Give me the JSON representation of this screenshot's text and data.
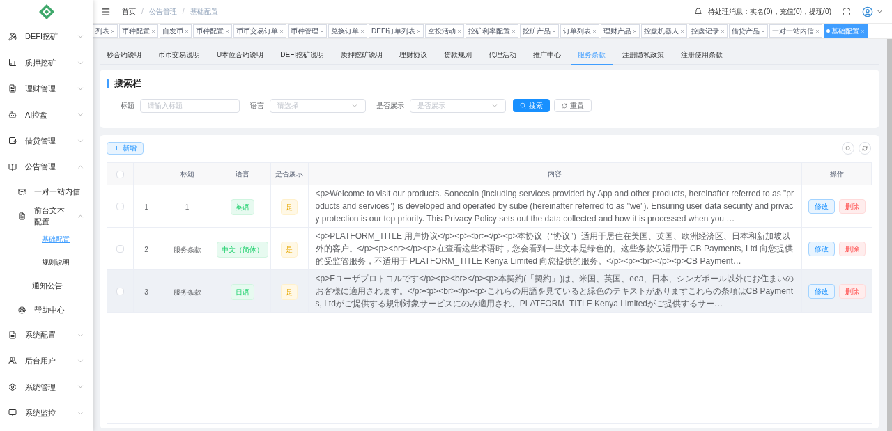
{
  "breadcrumb": {
    "separator": "/",
    "items": [
      "首页",
      "公告管理",
      "基础配置"
    ]
  },
  "header": {
    "notice": "待处理消息：实名(0)，充值(0)，提现(0)"
  },
  "sidebar": {
    "items": [
      {
        "label": "DEFI挖矿",
        "expanded": false
      },
      {
        "label": "质押挖矿",
        "expanded": false
      },
      {
        "label": "理财管理",
        "expanded": false
      },
      {
        "label": "AI控盘",
        "expanded": false
      },
      {
        "label": "借贷管理",
        "expanded": false
      },
      {
        "label": "公告管理",
        "expanded": true,
        "children": [
          {
            "label": "一对一站内信"
          },
          {
            "label": "前台文本配置",
            "expanded": true,
            "children": [
              {
                "label": "基础配置",
                "selected": true
              },
              {
                "label": "规则说明",
                "selected": false
              }
            ]
          },
          {
            "label": "通知公告"
          },
          {
            "label": "帮助中心"
          }
        ]
      },
      {
        "label": "系统配置",
        "expanded": false
      },
      {
        "label": "后台用户",
        "expanded": false
      },
      {
        "label": "系统管理",
        "expanded": false
      },
      {
        "label": "系统监控",
        "expanded": false
      }
    ]
  },
  "open_tabs": [
    {
      "label": "列表",
      "selected": false
    },
    {
      "label": "币种配置",
      "selected": false
    },
    {
      "label": "自发币",
      "selected": false
    },
    {
      "label": "币种配置",
      "selected": false
    },
    {
      "label": "币币交易订单",
      "selected": false
    },
    {
      "label": "币种管理",
      "selected": false
    },
    {
      "label": "兑换订单",
      "selected": false
    },
    {
      "label": "DEFI订单列表",
      "selected": false
    },
    {
      "label": "空投活动",
      "selected": false
    },
    {
      "label": "挖矿利率配置",
      "selected": false
    },
    {
      "label": "挖矿产品",
      "selected": false
    },
    {
      "label": "订单列表",
      "selected": false
    },
    {
      "label": "理财产品",
      "selected": false
    },
    {
      "label": "控盘机器人",
      "selected": false
    },
    {
      "label": "控盘记录",
      "selected": false
    },
    {
      "label": "借贷产品",
      "selected": false
    },
    {
      "label": "一对一站内信",
      "selected": false
    },
    {
      "label": "基础配置",
      "selected": true
    }
  ],
  "tabs": [
    {
      "label": "秒合约说明",
      "selected": false
    },
    {
      "label": "币币交易说明",
      "selected": false
    },
    {
      "label": "U本位合约说明",
      "selected": false
    },
    {
      "label": "DEFI挖矿说明",
      "selected": false
    },
    {
      "label": "质押挖矿说明",
      "selected": false
    },
    {
      "label": "理财协议",
      "selected": false
    },
    {
      "label": "贷款规则",
      "selected": false
    },
    {
      "label": "代理活动",
      "selected": false
    },
    {
      "label": "推广中心",
      "selected": false
    },
    {
      "label": "服务条款",
      "selected": true
    },
    {
      "label": "注册隐私政策",
      "selected": false
    },
    {
      "label": "注册使用条款",
      "selected": false
    }
  ],
  "search": {
    "title": "搜索栏",
    "fields": [
      {
        "label": "标题",
        "kind": "input",
        "placeholder": "请输入标题"
      },
      {
        "label": "语言",
        "kind": "select",
        "placeholder": "请选择"
      },
      {
        "label": "是否展示",
        "kind": "select",
        "placeholder": "是否展示"
      }
    ],
    "search_button": "搜索",
    "reset_button": "重置"
  },
  "toolbar": {
    "add_button": "新增"
  },
  "table": {
    "all_checked": false,
    "columns": [
      "标题",
      "语言",
      "是否展示",
      "内容",
      "操作"
    ],
    "rows": [
      {
        "index": "1",
        "title": "1",
        "language": "英语",
        "shown": "是",
        "content": "<p>Welcome to visit our products. Sonecoin (including services provided by App and other products, hereinafter referred to as \"products and services\") is developed and operated by sube (hereinafter referred to as \"we\"). Ensuring user data security and privacy protection is our top priority. This Privacy Policy sets out the data collected and how it is processed when you …",
        "checked": false,
        "highlighted": false,
        "edit": "修改",
        "delete": "删除"
      },
      {
        "index": "2",
        "title": "服务条款",
        "language": "中文（简体）",
        "shown": "是",
        "content": "<p>PLATFORM_TITLE 用户协议</p><p><br></p><p>本协议（“协议”）适用于居住在美国、英国、欧洲经济区、日本和新加坡以外的客户。</p><p><br></p><p>在查看这些术语时，您会看到一些文本是绿色的。这些条款仅适用于 CB Payments, Ltd 向您提供的受监管服务，不适用于 PLATFORM_TITLE Kenya Limited 向您提供的服务。</p><p><br></p><p>CB Payment…",
        "checked": false,
        "highlighted": false,
        "edit": "修改",
        "delete": "删除"
      },
      {
        "index": "3",
        "title": "服务条款",
        "language": "日语",
        "shown": "是",
        "content": "<p>Eユーザプロトコルです</p><p><br></p><p>本契約(「契約」)は、米国、英国、eea、日本、シンガポール以外にお住まいのお客様に適用されます。</p><p><br></p><p>これらの用語を見ていると緑色のテキストがありますこれらの条項はCB Payments, Ltdがご提供する規制対象サービスにのみ適用され、PLATFORM_TITLE Kenya Limitedがご提供するサー…",
        "checked": false,
        "highlighted": true,
        "edit": "修改",
        "delete": "删除"
      }
    ]
  }
}
